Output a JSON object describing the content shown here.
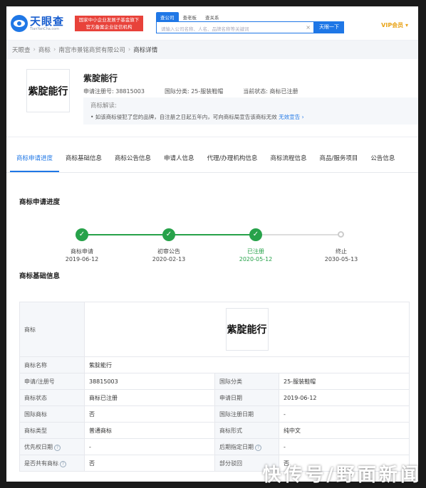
{
  "header": {
    "logo_cn": "天眼查",
    "logo_en": "TianYanCha.com",
    "badge_line1": "国家中小企业发展子基金旗下",
    "badge_line2": "官方备案企业征信机构",
    "search_tabs": [
      "查公司",
      "查老板",
      "查关系"
    ],
    "search_placeholder": "请输入公司名称、人名、品牌名称等关键词",
    "search_button": "天眼一下",
    "vip": "VIP会员"
  },
  "breadcrumb": [
    "天眼查",
    "商标",
    "南宫市景铭商贸有限公司",
    "商标详情"
  ],
  "trademark": {
    "logo_text": "紫腚能行",
    "name": "紫腚能行",
    "reg_no_label": "申请注册号:",
    "reg_no": "38815003",
    "intl_class_label": "国际分类:",
    "intl_class": "25-服装鞋帽",
    "status_label": "当前状态:",
    "status": "商标已注册",
    "explain_title": "商标解读:",
    "explain_text": "• 如该商标侵犯了您的品牌，自注册之日起五年内，可向商标局宣告该商标无效",
    "explain_link": "无效宣告"
  },
  "tabs": [
    "商标申请进度",
    "商标基础信息",
    "商标公告信息",
    "申请人信息",
    "代理/办理机构信息",
    "商标流程信息",
    "商品/服务项目",
    "公告信息"
  ],
  "progress": {
    "title": "商标申请进度",
    "steps": [
      {
        "label": "商标申请",
        "date": "2019-06-12"
      },
      {
        "label": "初审公告",
        "date": "2020-02-13"
      },
      {
        "label": "已注册",
        "date": "2020-05-12"
      },
      {
        "label": "终止",
        "date": "2030-05-13"
      }
    ]
  },
  "basic": {
    "title": "商标基础信息",
    "logo_label": "商标",
    "logo_text": "紫腚能行",
    "name_label": "商标名称",
    "name": "紫腚能行",
    "rows": [
      {
        "k1": "申请/注册号",
        "v1": "38815003",
        "k2": "国际分类",
        "v2": "25-服装鞋帽"
      },
      {
        "k1": "商标状态",
        "v1": "商标已注册",
        "k2": "申请日期",
        "v2": "2019-06-12"
      },
      {
        "k1": "国际商标",
        "v1": "否",
        "k2": "国际注册日期",
        "v2": "-"
      },
      {
        "k1": "商标类型",
        "v1": "普通商标",
        "k2": "商标形式",
        "v2": "纯中文"
      },
      {
        "k1": "优先权日期",
        "v1": "-",
        "k2": "后期指定日期",
        "v2": "-"
      },
      {
        "k1": "是否共有商标",
        "v1": "否",
        "k2": "部分驳回",
        "v2": "否"
      }
    ]
  },
  "watermark": "快传号/野面新闻"
}
